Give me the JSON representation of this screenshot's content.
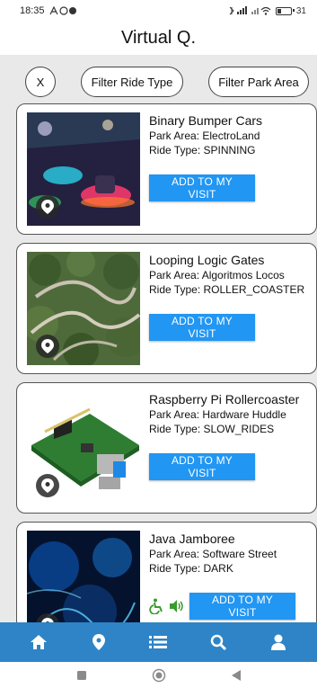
{
  "status_bar": {
    "time": "18:35",
    "battery": "31"
  },
  "header": {
    "title": "Virtual Q."
  },
  "filters": {
    "clear_label": "X",
    "ride_type_label": "Filter Ride Type",
    "park_area_label": "Filter Park Area"
  },
  "rides": [
    {
      "name": "Binary Bumper Cars",
      "park_area": "Park Area: ElectroLand",
      "ride_type": "Ride Type: SPINNING",
      "button": "ADD TO MY VISIT",
      "thumbnail_icon": "bumper-cars-photo"
    },
    {
      "name": "Looping Logic Gates",
      "park_area": "Park Area: Algoritmos Locos",
      "ride_type": "Ride Type: ROLLER_COASTER",
      "button": "ADD TO MY VISIT",
      "thumbnail_icon": "roller-coaster-photo"
    },
    {
      "name": "Raspberry Pi Rollercoaster",
      "park_area": "Park Area: Hardware Huddle",
      "ride_type": "Ride Type: SLOW_RIDES",
      "button": "ADD TO MY VISIT",
      "thumbnail_icon": "circuit-board-photo"
    },
    {
      "name": "Java Jamboree",
      "park_area": "Park Area: Software Street",
      "ride_type": "Ride Type: DARK",
      "button": "ADD TO MY VISIT",
      "thumbnail_icon": "dark-ride-photo",
      "accessibility_icons": [
        "wheelchair-icon",
        "audio-icon"
      ]
    }
  ],
  "bottom_nav": {
    "items": [
      "home-icon",
      "location-pin-icon",
      "list-icon",
      "search-icon",
      "user-icon"
    ]
  },
  "colors": {
    "accent": "#2196f3",
    "nav_bar": "#2e84c6",
    "accessibility_icon": "#3a9b2e",
    "list_background": "#e9e9e9"
  }
}
